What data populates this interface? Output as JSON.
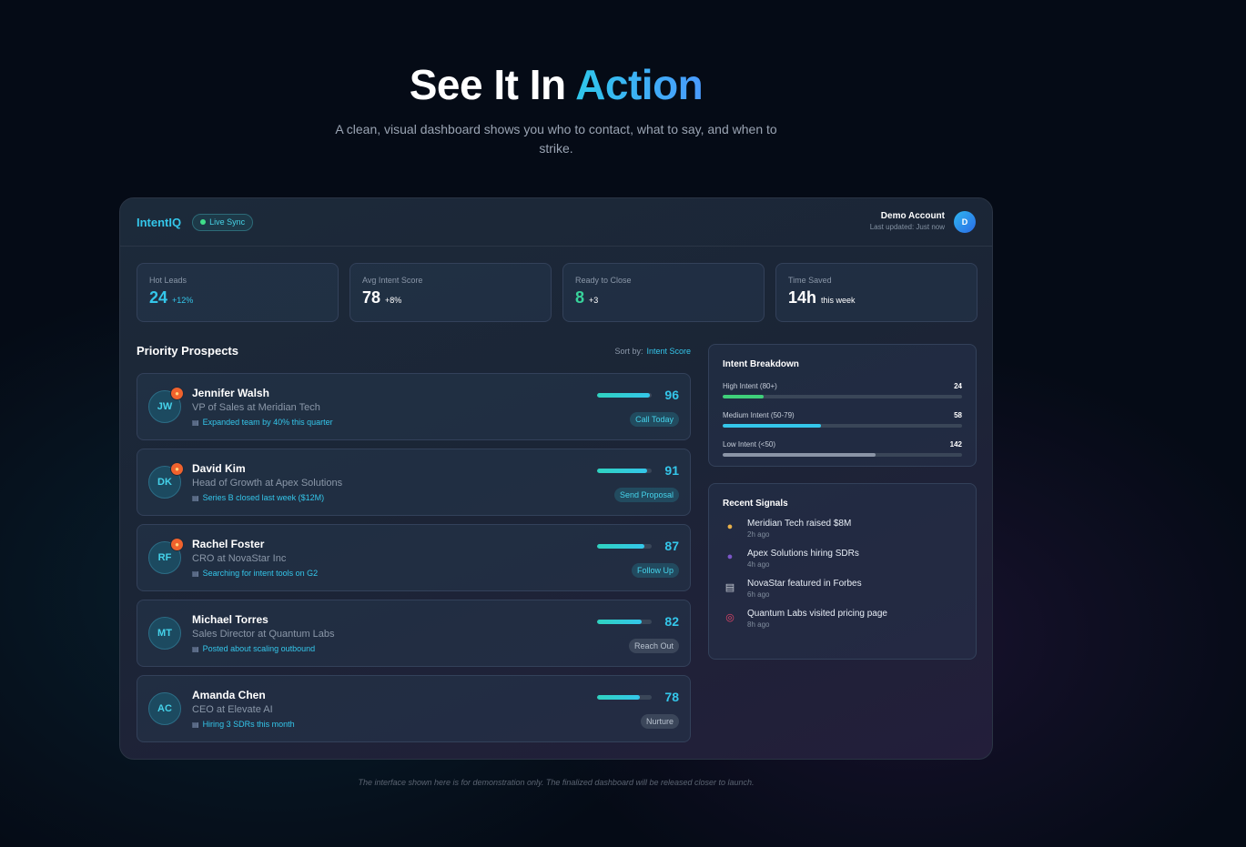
{
  "hero": {
    "title_main": "See It In ",
    "title_accent": "Action",
    "subtitle": "A clean, visual dashboard shows you who to contact, what to say, and when to strike."
  },
  "topbar": {
    "brand": "IntentIQ",
    "live_label": "Live Sync",
    "account_name": "Demo Account",
    "last_updated": "Last updated: Just now",
    "avatar_initial": "D"
  },
  "stats": [
    {
      "label": "Hot Leads",
      "value": "24",
      "delta": "+12%"
    },
    {
      "label": "Avg Intent Score",
      "value": "78",
      "delta": "+8%"
    },
    {
      "label": "Ready to Close",
      "value": "8",
      "delta": "+3"
    },
    {
      "label": "Time Saved",
      "value": "14h",
      "delta": "this week"
    }
  ],
  "prospects": {
    "title": "Priority Prospects",
    "sort_label": "Sort by:",
    "sort_value": "Intent Score",
    "items": [
      {
        "initials": "JW",
        "name": "Jennifer Walsh",
        "role": "VP of Sales at Meridian Tech",
        "signal": "Expanded team by 40% this quarter",
        "score": 96,
        "action": "Call Today",
        "hot": true
      },
      {
        "initials": "DK",
        "name": "David Kim",
        "role": "Head of Growth at Apex Solutions",
        "signal": "Series B closed last week ($12M)",
        "score": 91,
        "action": "Send Proposal",
        "hot": true
      },
      {
        "initials": "RF",
        "name": "Rachel Foster",
        "role": "CRO at NovaStar Inc",
        "signal": "Searching for intent tools on G2",
        "score": 87,
        "action": "Follow Up",
        "hot": true
      },
      {
        "initials": "MT",
        "name": "Michael Torres",
        "role": "Sales Director at Quantum Labs",
        "signal": "Posted about scaling outbound",
        "score": 82,
        "action": "Reach Out",
        "hot": false
      },
      {
        "initials": "AC",
        "name": "Amanda Chen",
        "role": "CEO at Elevate AI",
        "signal": "Hiring 3 SDRs this month",
        "score": 78,
        "action": "Nurture",
        "hot": false
      }
    ]
  },
  "breakdown": {
    "title": "Intent Breakdown",
    "rows": [
      {
        "label": "High Intent (80+)",
        "value": "24",
        "fraction": 0.17,
        "color": "#3fd07a"
      },
      {
        "label": "Medium Intent (50-79)",
        "value": "58",
        "fraction": 0.41,
        "color": "#34c6ea"
      },
      {
        "label": "Low Intent (<50)",
        "value": "142",
        "fraction": 0.64,
        "color": "#8a94a6"
      }
    ]
  },
  "signals": {
    "title": "Recent Signals",
    "items": [
      {
        "text": "Meridian Tech raised $8M",
        "ago": "2h ago",
        "icon": "money-bag-icon"
      },
      {
        "text": "Apex Solutions hiring SDRs",
        "ago": "4h ago",
        "icon": "people-icon"
      },
      {
        "text": "NovaStar featured in Forbes",
        "ago": "6h ago",
        "icon": "newspaper-icon"
      },
      {
        "text": "Quantum Labs visited pricing page",
        "ago": "8h ago",
        "icon": "target-icon"
      }
    ]
  },
  "disclaimer": "The interface shown here is for demonstration only. The finalized dashboard will be released closer to launch."
}
